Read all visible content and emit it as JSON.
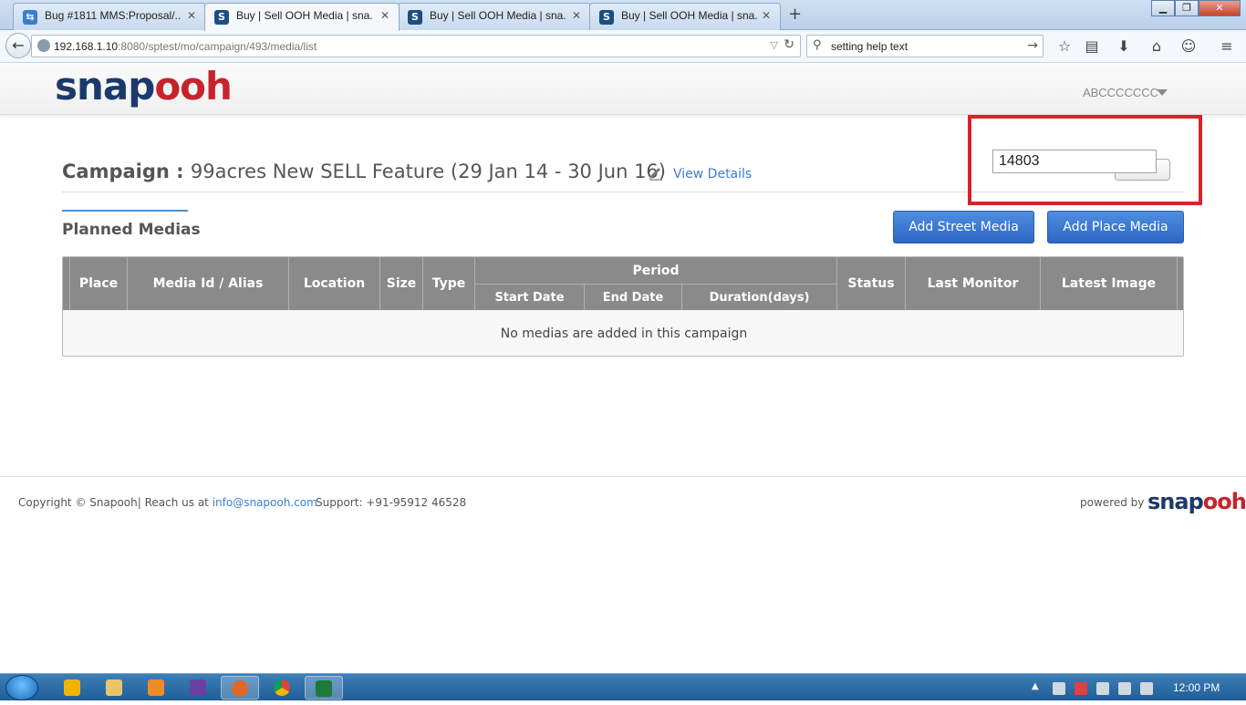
{
  "browser": {
    "tabs": [
      {
        "label": "Bug #1811 MMS:Proposal/...",
        "icon": "redmine-icon"
      },
      {
        "label": "Buy | Sell OOH Media | sna...",
        "icon": "snapooh-favicon"
      },
      {
        "label": "Buy | Sell OOH Media | sna...",
        "icon": "snapooh-favicon"
      },
      {
        "label": "Buy | Sell OOH Media | sna...",
        "icon": "snapooh-favicon"
      }
    ],
    "url_host": "192.168.1.10",
    "url_rest": ":8080/sptest/mo/campaign/493/media/list",
    "search_text": "setting help text"
  },
  "app": {
    "logo_part1": "snap",
    "logo_part2": "ooh",
    "user_name": "ABCCCCCCC",
    "campaign_prefix": "Campaign : ",
    "campaign_name": "99acres New SELL Feature (29 Jan 14 - 30 Jun 16)",
    "view_details": "View Details",
    "search_value": "14803",
    "section_title": "Planned Medias",
    "add_street_media": "Add Street Media",
    "add_place_media": "Add Place Media",
    "table": {
      "headers": [
        "Place",
        "Media Id / Alias",
        "Location",
        "Size",
        "Type",
        "Period",
        "Status",
        "Last Monitor",
        "Latest Image"
      ],
      "period_subheaders": [
        "Start Date",
        "End Date",
        "Duration(days)"
      ],
      "empty_message": "No medias are added in this campaign"
    }
  },
  "footer": {
    "copyright": "Copyright © Snapooh| Reach us at ",
    "email": "info@snapooh.com",
    "support": "Support: +91-95912 46528",
    "powered_by": "powered by"
  },
  "taskbar": {
    "clock": "12:00 PM"
  },
  "colors": {
    "accent_blue": "#3a7ed0",
    "brand_navy": "#1b3a6b",
    "brand_red": "#c8232c",
    "highlight_red": "#d8232a",
    "table_header": "#8a8a8a"
  }
}
